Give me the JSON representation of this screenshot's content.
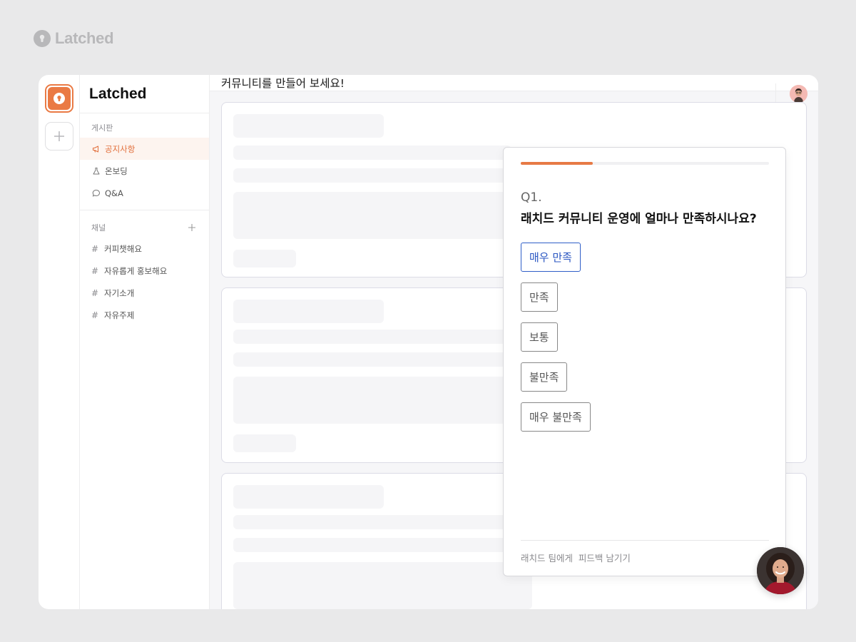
{
  "brand": {
    "name": "Latched",
    "logo_icon": "keyhole-icon"
  },
  "rail": {
    "app_icon": "keyhole-icon",
    "add_icon": "plus-icon",
    "accent": "#ea7a44"
  },
  "sidebar": {
    "title": "Latched",
    "board_section_label": "게시판",
    "board_items": [
      {
        "label": "공지사항",
        "icon": "megaphone-icon",
        "active": true
      },
      {
        "label": "온보딩",
        "icon": "flask-icon",
        "active": false
      },
      {
        "label": "Q&A",
        "icon": "speech-bubble-icon",
        "active": false
      }
    ],
    "channel_section_label": "채널",
    "channel_add_icon": "plus-icon",
    "channels": [
      {
        "label": "커피챗해요"
      },
      {
        "label": "자유롭게 홍보해요"
      },
      {
        "label": "자기소개"
      },
      {
        "label": "자유주제"
      }
    ],
    "channel_prefix": "#"
  },
  "topbar": {
    "title": "커뮤니티를 만들어 보세요!",
    "avatar_icon": "user-avatar"
  },
  "survey": {
    "progress": 0.29,
    "question_number": "Q1.",
    "question": "래치드 커뮤니티 운영에 얼마나 만족하시나요?",
    "options": [
      {
        "label": "매우 만족",
        "selected": true
      },
      {
        "label": "만족",
        "selected": false
      },
      {
        "label": "보통",
        "selected": false
      },
      {
        "label": "불만족",
        "selected": false
      },
      {
        "label": "매우 불만족",
        "selected": false
      }
    ],
    "footer": "래치드 팀에게  피드백 남기기"
  },
  "colors": {
    "accent_orange": "#e77a45",
    "selected_blue": "#2f5ec8",
    "background": "#e9e9ea"
  }
}
